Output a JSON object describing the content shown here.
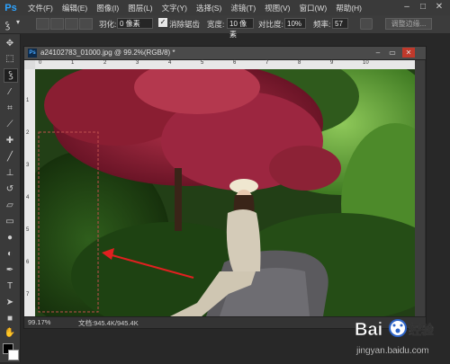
{
  "app": {
    "logo": "Ps"
  },
  "menubar": {
    "items": [
      "文件(F)",
      "编辑(E)",
      "图像(I)",
      "图层(L)",
      "文字(Y)",
      "选择(S)",
      "滤镜(T)",
      "视图(V)",
      "窗口(W)",
      "帮助(H)"
    ]
  },
  "options": {
    "feather_label": "羽化:",
    "feather_value": "0 像素",
    "antialias_label": "消除锯齿",
    "width_label": "宽度:",
    "width_value": "10 像素",
    "contrast_label": "对比度:",
    "contrast_value": "10%",
    "frequency_label": "频率:",
    "frequency_value": "57",
    "refine_edge_label": "调整边缘..."
  },
  "document": {
    "title": "a24102783_01000.jpg @ 99.2%(RGB/8) *",
    "ruler_h": [
      "0",
      "1",
      "2",
      "3",
      "4",
      "5",
      "6",
      "7",
      "8",
      "9",
      "10"
    ],
    "ruler_v": [
      "1",
      "2",
      "3",
      "4",
      "5",
      "6",
      "7"
    ],
    "zoom": "99.17%",
    "doc_info": "文档:945.4K/945.4K"
  },
  "watermark": {
    "brand": "Bai",
    "brand_cn": "经验",
    "url": "jingyan.baidu.com"
  },
  "icons": {
    "tools": [
      "move-icon",
      "marquee-icon",
      "lasso-icon",
      "quick-select-icon",
      "crop-icon",
      "eyedropper-icon",
      "healing-icon",
      "brush-icon",
      "stamp-icon",
      "history-brush-icon",
      "eraser-icon",
      "gradient-icon",
      "blur-icon",
      "dodge-icon",
      "pen-icon",
      "type-icon",
      "path-select-icon",
      "rectangle-icon",
      "hand-icon",
      "zoom-icon"
    ]
  },
  "colors": {
    "annotation_red": "#e02020",
    "accent_blue": "#2da3ff"
  }
}
